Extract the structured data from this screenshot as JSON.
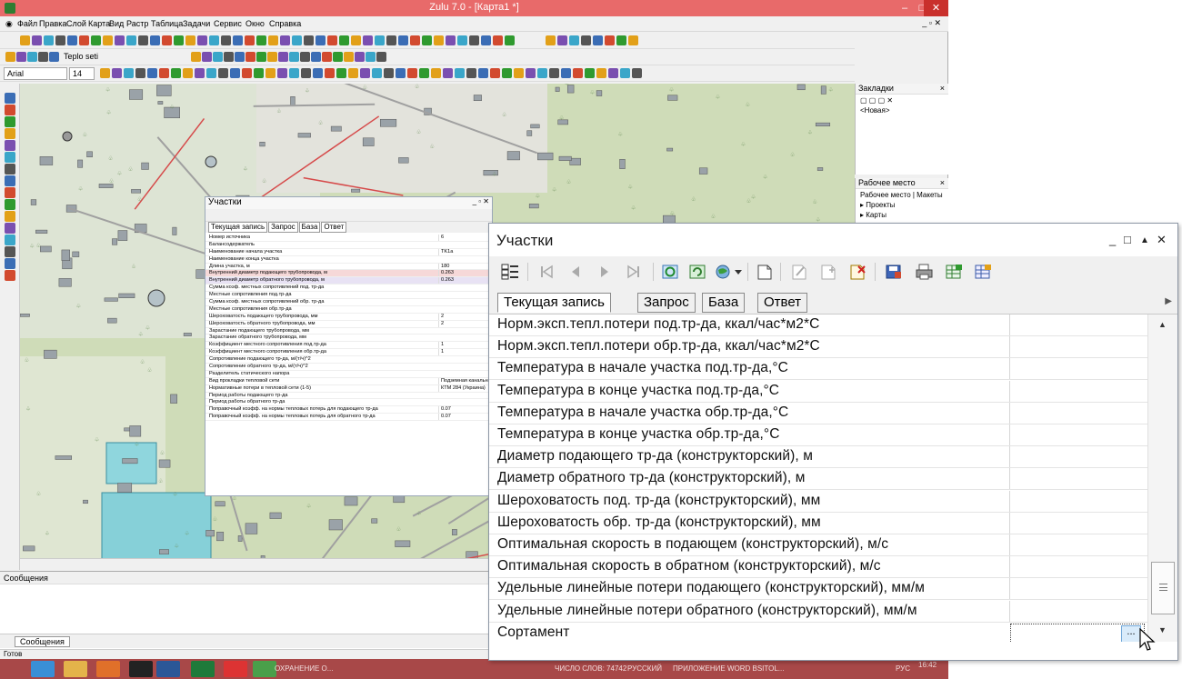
{
  "app": {
    "title": "Zulu 7.0 - [Карта1 *]",
    "menu": [
      "Файл",
      "Правка",
      "Слой",
      "Карта",
      "Вид",
      "Растр",
      "Таблица",
      "Задачи",
      "Сервис",
      "Окно",
      "Справка"
    ],
    "toolbar_layer": "Teplo seti",
    "font_name": "Arial",
    "font_size": "14",
    "status": "Готов"
  },
  "panels": {
    "bookmarks_title": "Закладки",
    "bookmarks_item": "<Новая>",
    "workspace_title": "Рабочее место",
    "workspace_tab1": "Рабочее место",
    "workspace_tab2": "Макеты",
    "workspace_item1": "Проекты",
    "workspace_item2": "Карты",
    "messages_title": "Сообщения",
    "messages_tab": "Сообщения"
  },
  "small_window": {
    "title": "Участки",
    "tabs": [
      "Текущая запись",
      "Запрос",
      "База",
      "Ответ"
    ],
    "rows": [
      {
        "name": "Номер источника",
        "value": "6"
      },
      {
        "name": "Балансодержатель",
        "value": ""
      },
      {
        "name": "Наименование начала участка",
        "value": "TK1a"
      },
      {
        "name": "Наименование конца участка",
        "value": ""
      },
      {
        "name": "Длина участка, м",
        "value": "180"
      },
      {
        "name": "Внутренний диаметр подающего трубопровода, м",
        "value": "0.263"
      },
      {
        "name": "Внутренний диаметр обратного трубопровода, м",
        "value": "0.263"
      },
      {
        "name": "Сумма коэф. местных сопротивлений под. тр-да",
        "value": ""
      },
      {
        "name": "Местные сопротивления под.тр-да",
        "value": ""
      },
      {
        "name": "Сумма коэф. местных сопротивлений обр. тр-да",
        "value": ""
      },
      {
        "name": "Местные сопротивления обр.тр-да",
        "value": ""
      },
      {
        "name": "Шероховатость подающего трубопровода, мм",
        "value": "2"
      },
      {
        "name": "Шероховатость обратного трубопровода, мм",
        "value": "2"
      },
      {
        "name": "Зарастание подающего трубопровода, мм",
        "value": ""
      },
      {
        "name": "Зарастание обратного трубопровода, мм",
        "value": ""
      },
      {
        "name": "Коэффициент местного сопротивления под.тр-да",
        "value": "1"
      },
      {
        "name": "Коэффициент местного сопротивления обр.тр-да",
        "value": "1"
      },
      {
        "name": "Сопротивление подающего тр-да, м/(т/ч)^2",
        "value": ""
      },
      {
        "name": "Сопротивление обратного тр-да, м/(т/ч)^2",
        "value": ""
      },
      {
        "name": "Разделитель статического напора",
        "value": ""
      },
      {
        "name": "Вид прокладки тепловой сети",
        "value": "Подземная канальная"
      },
      {
        "name": "Нормативные потери в тепловой сети (1-5)",
        "value": "КТМ 284 (Украина)"
      },
      {
        "name": "Период работы подающего тр-да",
        "value": ""
      },
      {
        "name": "Период работы обратного тр-да",
        "value": ""
      },
      {
        "name": "Поправочный коэфф. на нормы тепловых потерь для подающего тр-да",
        "value": "0.07"
      },
      {
        "name": "Поправочный коэфф. на нормы тепловых потерь для обратного тр-да",
        "value": "0.07"
      }
    ]
  },
  "big_window": {
    "title": "Участки",
    "tabs": [
      "Текущая запись",
      "Запрос",
      "База",
      "Ответ"
    ],
    "rows": [
      {
        "name": "Норм.эксп.тепл.потери под.тр-да, ккал/час*м2*С",
        "value": ""
      },
      {
        "name": "Норм.эксп.тепл.потери обр.тр-да, ккал/час*м2*С",
        "value": ""
      },
      {
        "name": "Температура в начале участка под.тр-да,°С",
        "value": ""
      },
      {
        "name": "Температура в конце участка под.тр-да,°С",
        "value": ""
      },
      {
        "name": "Температура в начале участка обр.тр-да,°С",
        "value": ""
      },
      {
        "name": "Температура в конце участка обр.тр-да,°С",
        "value": ""
      },
      {
        "name": "Диаметр подающего тр-да (конструкторский), м",
        "value": ""
      },
      {
        "name": "Диаметр обратного тр-да (конструкторский), м",
        "value": ""
      },
      {
        "name": "Шероховатость под. тр-да (конструкторский), мм",
        "value": ""
      },
      {
        "name": "Шероховатость обр. тр-да (конструкторский), мм",
        "value": ""
      },
      {
        "name": "Оптимальная скорость в подающем (конструкторский), м/с",
        "value": ""
      },
      {
        "name": "Оптимальная скорость в обратном (конструкторский), м/с",
        "value": ""
      },
      {
        "name": "Удельные линейные потери подающего (конструкторский), мм/м",
        "value": ""
      },
      {
        "name": "Удельные линейные потери обратного (конструкторский), мм/м",
        "value": ""
      },
      {
        "name": "Сортамент",
        "value": ""
      }
    ],
    "ellipsis": "..."
  },
  "taskbar": {
    "item1": "ОХРАНЕНИЕ О...",
    "item2": "ЧИСЛО СЛОВ: 74742",
    "item3": "РУССКИЙ",
    "item4": "ПРИЛОЖЕНИЕ WORD BSITOL...",
    "lang": "РУС",
    "time": "16:42",
    "date": "02.06.2016"
  }
}
